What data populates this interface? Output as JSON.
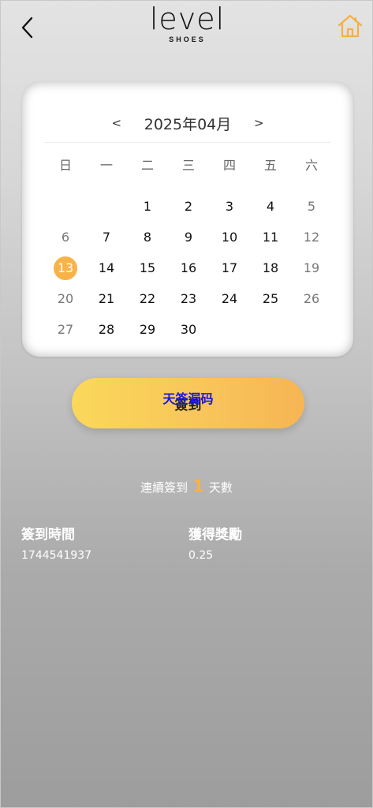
{
  "header": {
    "logo_main": "level",
    "logo_sub": "SHOES",
    "back_icon": "chevron-left-icon",
    "home_icon": "home-icon",
    "home_icon_color": "#f5b041"
  },
  "calendar": {
    "prev": "<",
    "next": ">",
    "month": "2025年04月",
    "weekdays": [
      "日",
      "一",
      "二",
      "三",
      "四",
      "五",
      "六"
    ],
    "leading_blanks": 2,
    "days": [
      1,
      2,
      3,
      4,
      5,
      6,
      7,
      8,
      9,
      10,
      11,
      12,
      13,
      14,
      15,
      16,
      17,
      18,
      19,
      20,
      21,
      22,
      23,
      24,
      25,
      26,
      27,
      28,
      29,
      30
    ],
    "selected_day": 13,
    "selected_color": "#f7b347"
  },
  "checkin": {
    "label": "簽到",
    "overlay_text": "天签漏码"
  },
  "streak": {
    "prefix": "連續簽到",
    "count": "1",
    "suffix": "天數"
  },
  "records": {
    "time_label": "簽到時間",
    "time_value": "1744541937",
    "reward_label": "獲得獎勵",
    "reward_value": "0.25"
  },
  "colors": {
    "accent": "#f7b347",
    "button_start": "#fad85a",
    "button_end": "#f6b553",
    "overlay_text": "#1a17e0"
  }
}
